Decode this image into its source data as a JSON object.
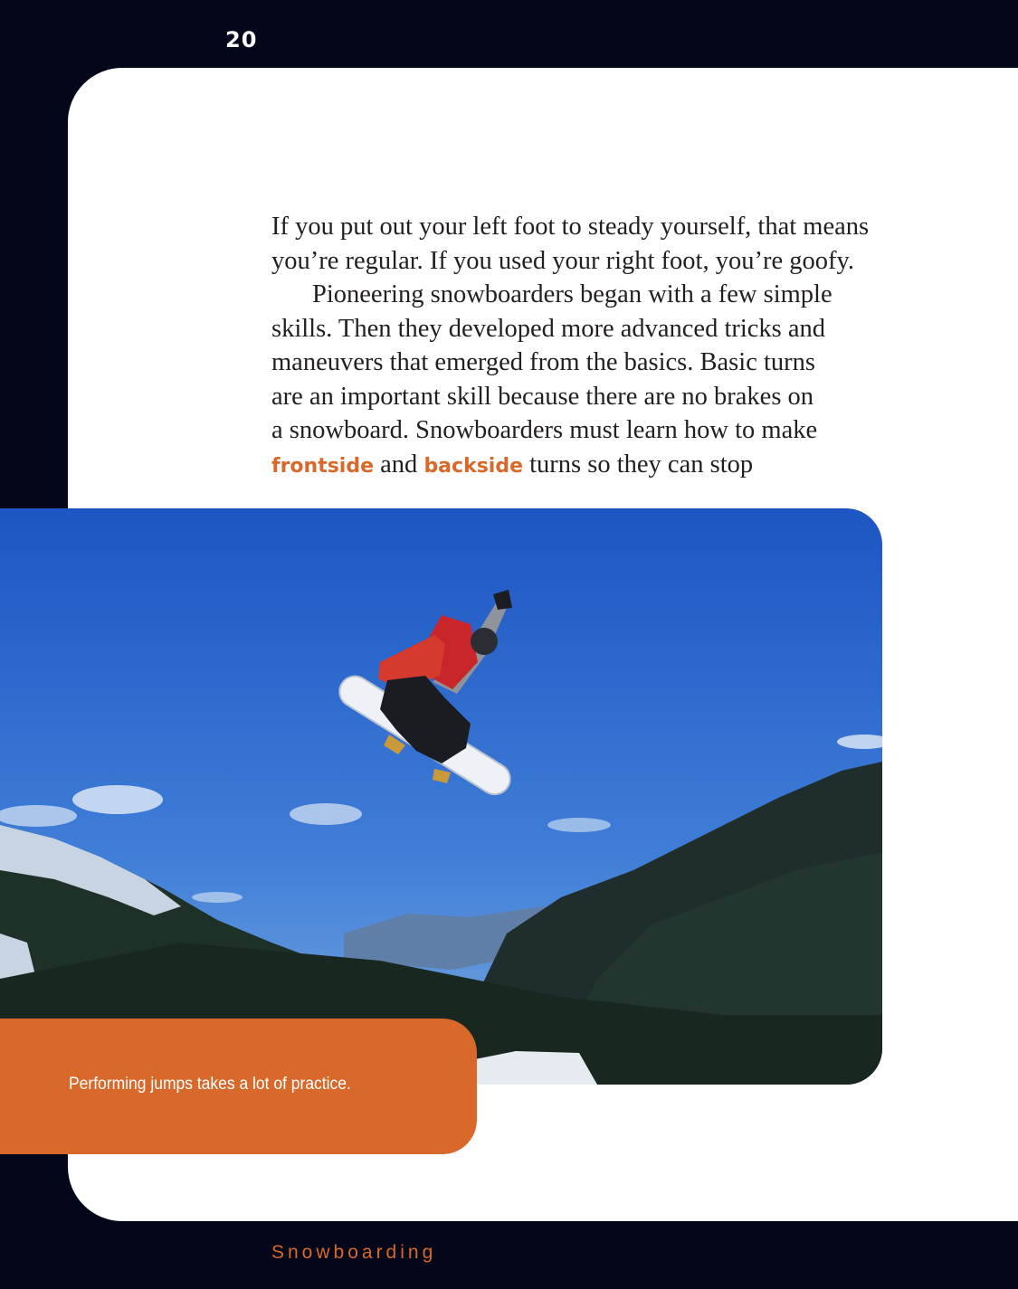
{
  "page": {
    "number": "20",
    "footer_title": "Snowboarding"
  },
  "body": {
    "line1": "If you put out your left foot to steady yourself, that means",
    "line2": "you’re regular. If you used your right foot, you’re goofy.",
    "line3": "Pioneering snowboarders began with a few simple",
    "line4": "skills. Then they developed more advanced tricks and",
    "line5": "maneuvers that emerged from the basics. Basic turns",
    "line6": "are an important skill because there are no brakes on",
    "line7": "a snowboard. Snowboarders must learn how to make",
    "term1": "frontside",
    "connector": " and ",
    "term2": "backside",
    "line8_rest": " turns so they can stop"
  },
  "photo": {
    "caption": "Performing jumps takes a lot of practice."
  },
  "colors": {
    "accent": "#d8692a",
    "background": "#04061a",
    "panel": "#ffffff"
  }
}
